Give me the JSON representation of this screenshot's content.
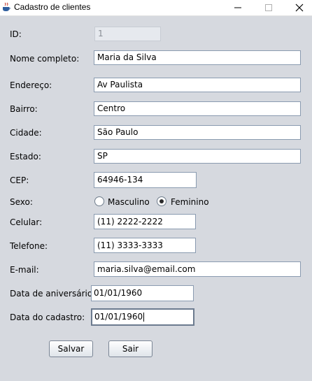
{
  "window": {
    "title": "Cadastro de clientes",
    "app_icon": "java-cup-icon",
    "controls": [
      "minimize-icon",
      "maximize-icon",
      "close-icon"
    ]
  },
  "form": {
    "id": {
      "label": "ID:",
      "value": "1"
    },
    "nome": {
      "label": "Nome completo:",
      "value": "Maria da Silva"
    },
    "endereco": {
      "label": "Endereço:",
      "value": "Av Paulista"
    },
    "bairro": {
      "label": "Bairro:",
      "value": "Centro"
    },
    "cidade": {
      "label": "Cidade:",
      "value": "São Paulo"
    },
    "estado": {
      "label": "Estado:",
      "value": "SP"
    },
    "cep": {
      "label": "CEP:",
      "value": "64946-134"
    },
    "sexo": {
      "label": "Sexo:",
      "options": [
        "Masculino",
        "Feminino"
      ],
      "selected": "Feminino"
    },
    "celular": {
      "label": "Celular:",
      "value": "(11) 2222-2222"
    },
    "telefone": {
      "label": "Telefone:",
      "value": "(11) 3333-3333"
    },
    "email": {
      "label": "E-mail:",
      "value": "maria.silva@email.com"
    },
    "aniversario": {
      "label": "Data de aniversário:",
      "value": "01/01/1960"
    },
    "data_cadastro": {
      "label": "Data do cadastro:",
      "value": "01/01/1960"
    }
  },
  "buttons": {
    "salvar": "Salvar",
    "sair": "Sair"
  },
  "colors": {
    "background": "#d6d9df",
    "field_border": "#8a9bb0",
    "titlebar": "#ffffff"
  }
}
